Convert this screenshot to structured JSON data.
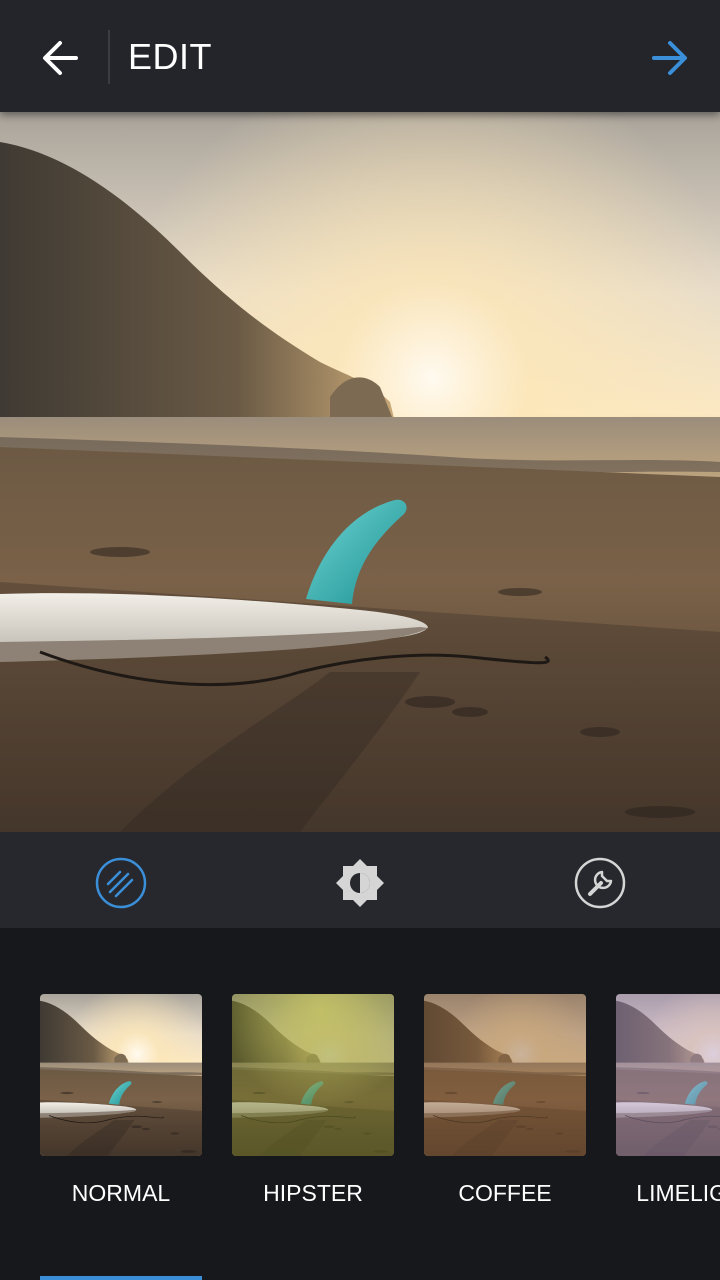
{
  "header": {
    "title": "EDIT",
    "back_icon": "arrow-left-icon",
    "next_icon": "arrow-right-icon",
    "accent": "#3b8fd9"
  },
  "photo": {
    "subject": "surfboard on beach at sunset"
  },
  "tools": [
    {
      "name": "filter",
      "icon": "filter-icon",
      "active": true
    },
    {
      "name": "lux",
      "icon": "lux-icon",
      "active": false
    },
    {
      "name": "tools",
      "icon": "wrench-icon",
      "active": false
    }
  ],
  "filters": [
    {
      "label": "NORMAL",
      "selected": true
    },
    {
      "label": "HIPSTER",
      "selected": false
    },
    {
      "label": "COFFEE",
      "selected": false
    },
    {
      "label": "LIMELIGHT",
      "selected": false
    }
  ],
  "colors": {
    "header_bg": "#23252a",
    "tools_bg": "#26282d",
    "filters_bg": "#16181c",
    "active_tool": "#3b8fd9"
  }
}
